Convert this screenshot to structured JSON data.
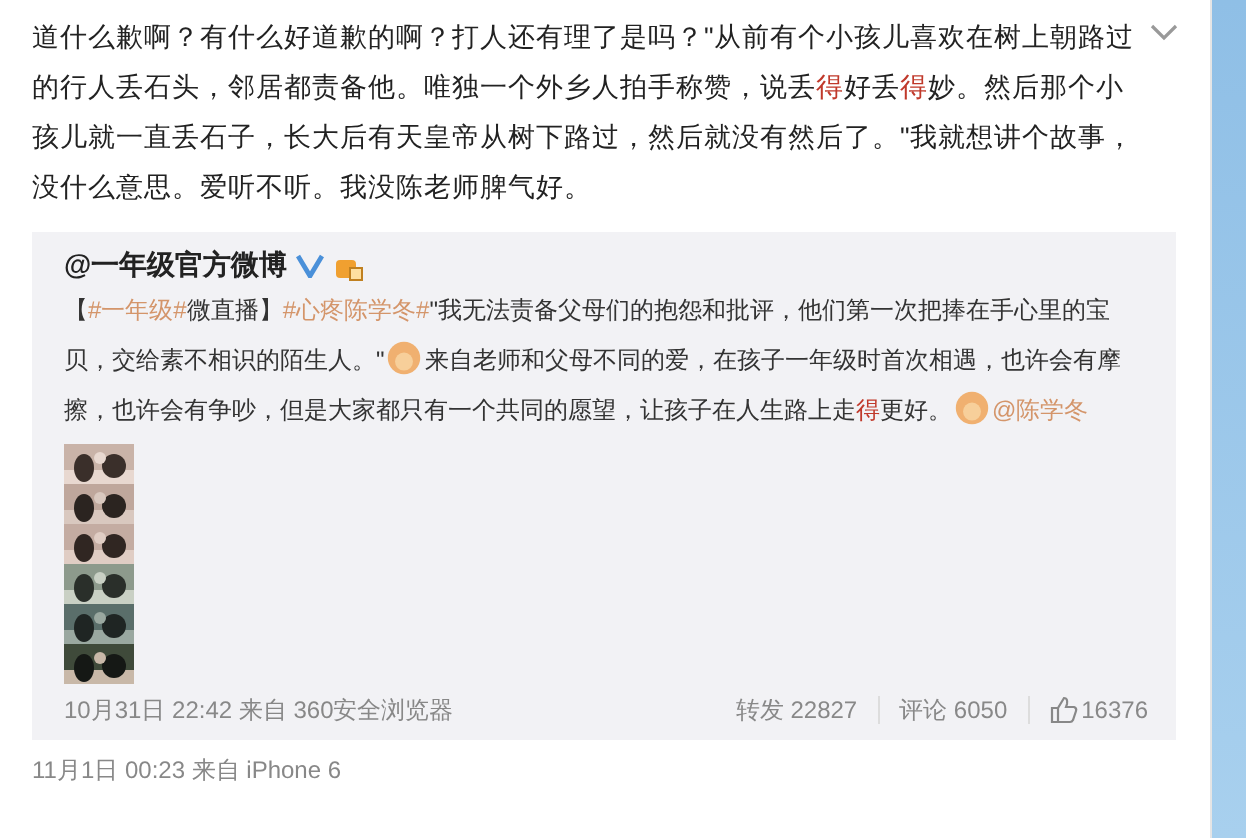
{
  "post": {
    "text": [
      {
        "kind": "text",
        "text": "道什么歉啊？有什么好道歉的啊？打人还有理了是吗？\"从前有个小孩儿喜欢在树上朝路过的行人丢石头，邻居都责备他。唯独一个外乡人拍手称赞，说丢"
      },
      {
        "kind": "emphasis",
        "text": "得"
      },
      {
        "kind": "text",
        "text": "好丢"
      },
      {
        "kind": "emphasis",
        "text": "得"
      },
      {
        "kind": "text",
        "text": "妙。然后那个小孩儿就一直丢石子，长大后有天皇帝从树下路过，然后就没有然后了。\"我就想讲个故事，没什么意思。爱听不听。我没陈老师脾气好。"
      }
    ],
    "quoted": {
      "author": "@一年级官方微博",
      "verified": true,
      "text": [
        {
          "kind": "text",
          "text": "【"
        },
        {
          "kind": "topic",
          "text": "#一年级#"
        },
        {
          "kind": "text",
          "text": "微直播】"
        },
        {
          "kind": "topic",
          "text": "#心疼陈学冬#"
        },
        {
          "kind": "text",
          "text": "\"我无法责备父母们的抱怨和批评，他们第一次把捧在手心里的宝贝，交给素不相识的陌生人。\""
        },
        {
          "kind": "emoji"
        },
        {
          "kind": "text",
          "text": "来自老师和父母不同的爱，在孩子一年级时首次相遇，也许会有摩擦，也许会有争吵，但是大家都只有一个共同的愿望，让孩子在人生路上走"
        },
        {
          "kind": "emphasis",
          "text": "得"
        },
        {
          "kind": "text",
          "text": "更好。"
        },
        {
          "kind": "emoji"
        },
        {
          "kind": "mention",
          "text": "@陈学冬"
        }
      ],
      "time": "10月31日 22:42 来自 360安全浏览器",
      "reposts": "转发 22827",
      "comments": "评论 6050",
      "likes": "16376"
    },
    "time": "11月1日 00:23 来自 iPhone 6"
  }
}
